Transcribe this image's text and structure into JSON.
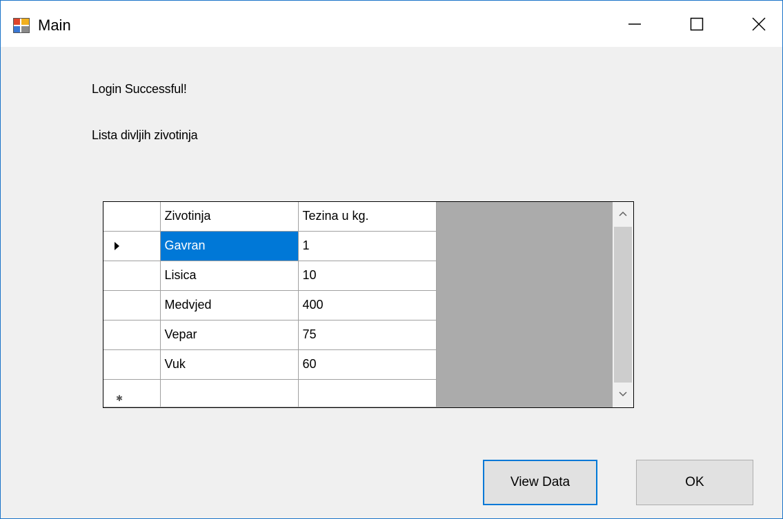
{
  "window": {
    "title": "Main",
    "icon": "form-app-icon",
    "controls": [
      "minimize-icon",
      "maximize-icon",
      "close-icon"
    ]
  },
  "labels": {
    "login_status": "Login Successful!",
    "list_title": "Lista divljih zivotinja"
  },
  "grid": {
    "columns": [
      "Zivotinja",
      "Tezina u kg."
    ],
    "rows": [
      {
        "animal": "Gavran",
        "weight": "1"
      },
      {
        "animal": "Lisica",
        "weight": "10"
      },
      {
        "animal": "Medvjed",
        "weight": "400"
      },
      {
        "animal": "Vepar",
        "weight": "75"
      },
      {
        "animal": "Vuk",
        "weight": "60"
      }
    ],
    "selected_row": 0,
    "selection_color": "#0078d7"
  },
  "buttons": {
    "view_data": "View Data",
    "ok": "OK"
  },
  "colors": {
    "window_border": "#1a73c9",
    "focus_border": "#0078d7",
    "grid_background": "#ababab"
  }
}
